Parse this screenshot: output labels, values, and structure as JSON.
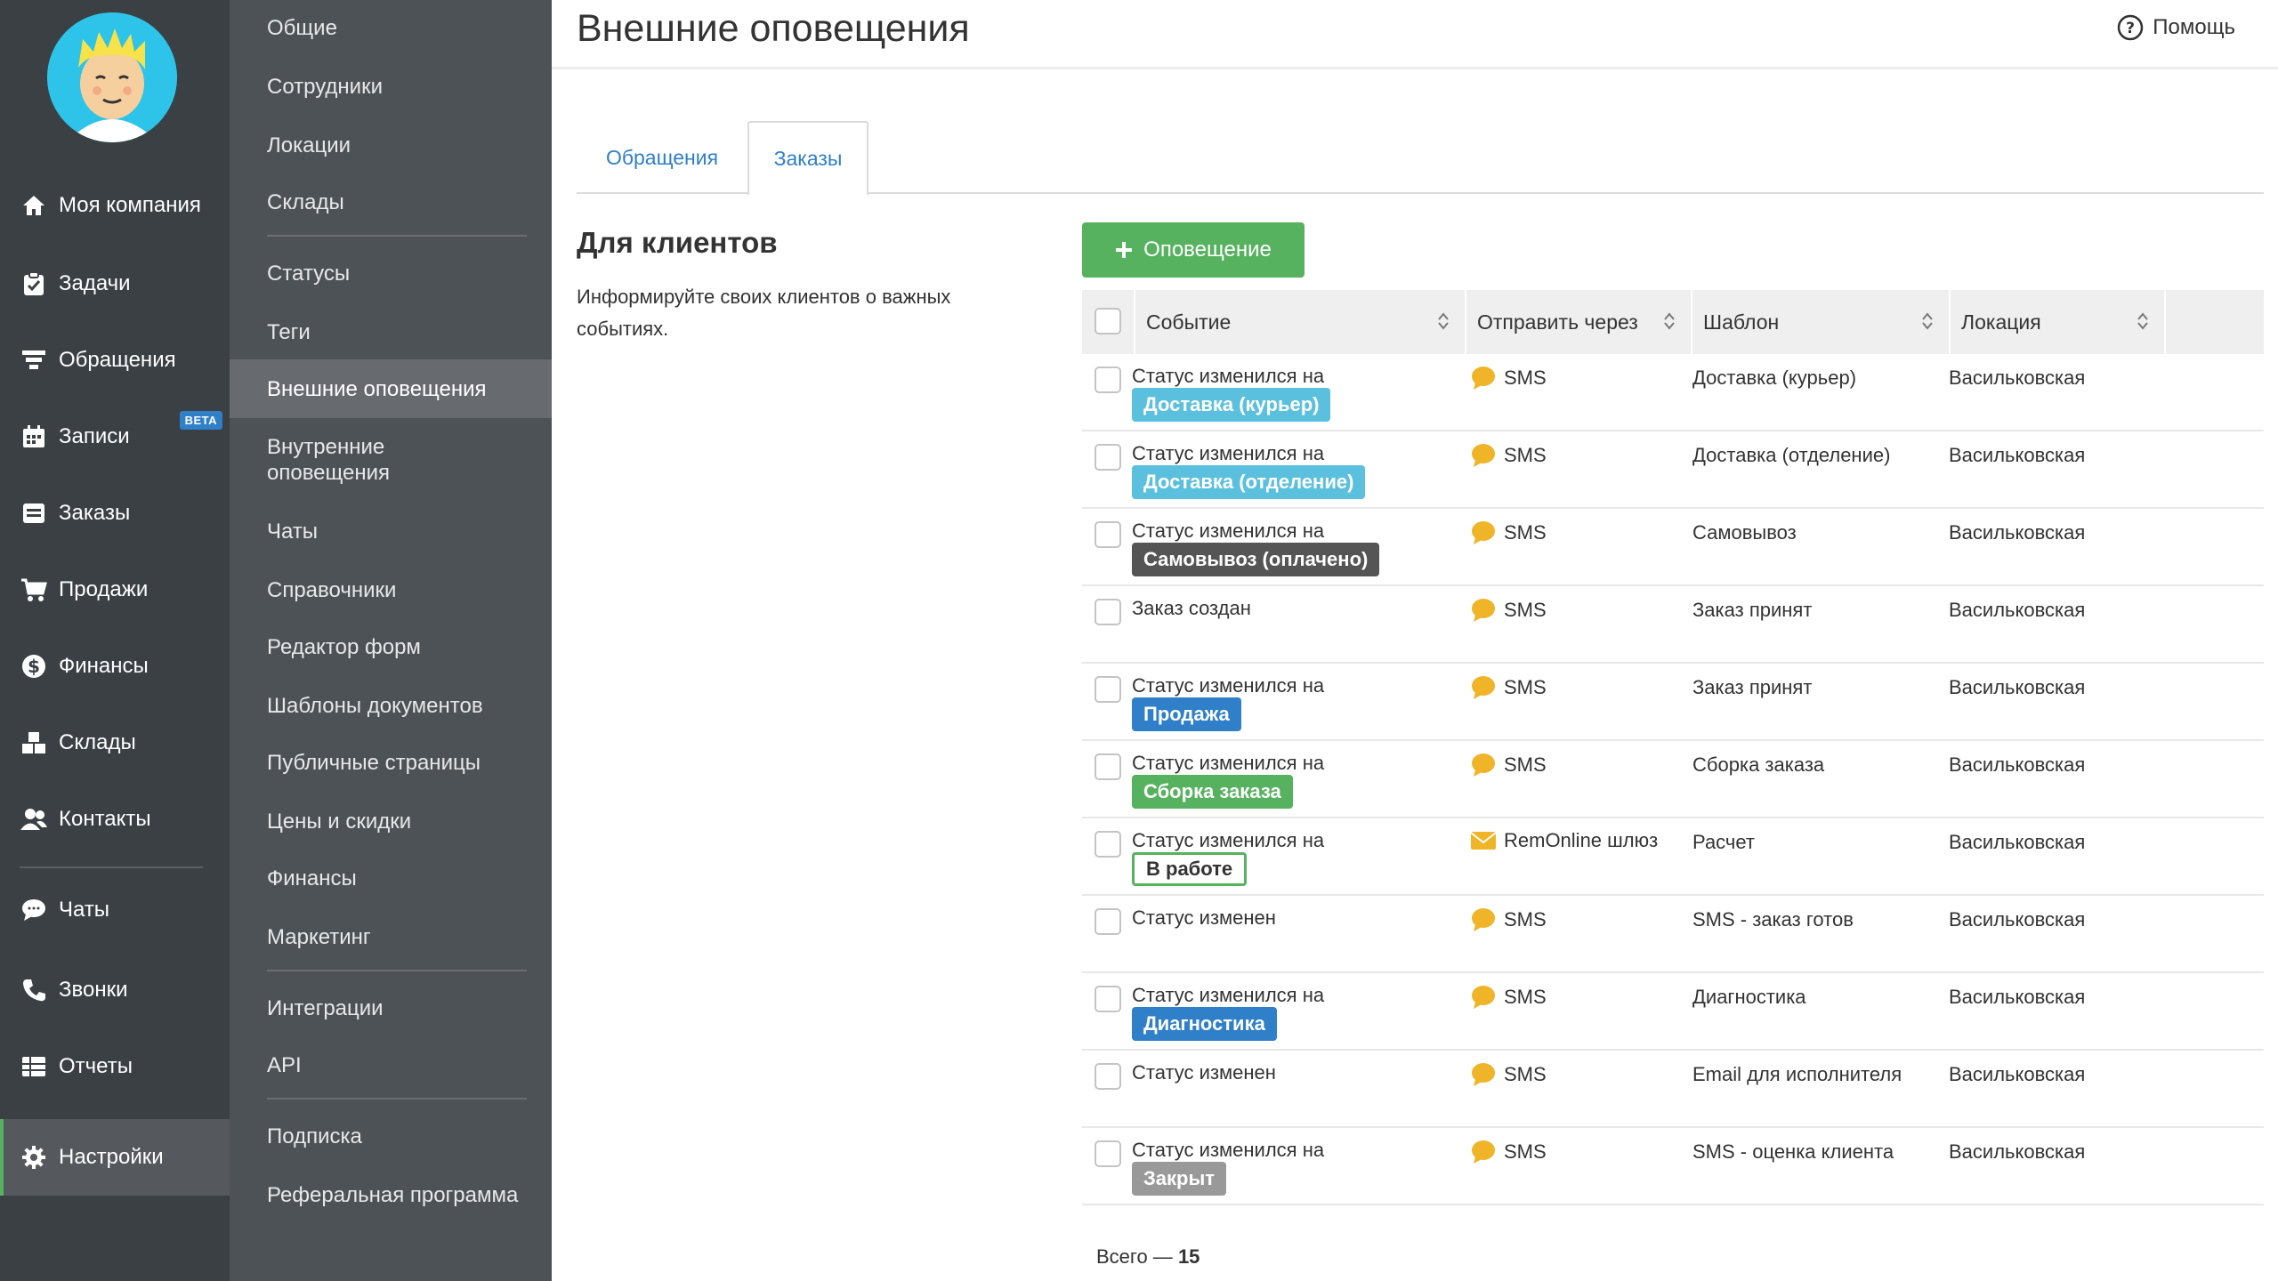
{
  "colors": {
    "nav_bg": "#3b4044",
    "subnav_bg": "#4d5256",
    "accent_green": "#57b25f",
    "link_blue": "#2f7fc9",
    "badge_courier": "#5bc0de",
    "badge_pickup_paid": "#555555",
    "badge_sale": "#2f7fc9",
    "badge_assembly": "#57b25f",
    "badge_diag": "#2f7fc9",
    "badge_closed": "#999999",
    "sms_icon": "#f0b429",
    "mail_icon": "#f0b429"
  },
  "nav": {
    "items": [
      {
        "label": "Моя компания",
        "icon": "home-icon"
      },
      {
        "label": "Задачи",
        "icon": "clipboard-icon"
      },
      {
        "label": "Обращения",
        "icon": "funnel-icon"
      },
      {
        "label": "Записи",
        "icon": "calendar-icon",
        "badge": "BETA"
      },
      {
        "label": "Заказы",
        "icon": "orders-icon"
      },
      {
        "label": "Продажи",
        "icon": "cart-icon"
      },
      {
        "label": "Финансы",
        "icon": "dollar-icon"
      },
      {
        "label": "Склады",
        "icon": "boxes-icon"
      },
      {
        "label": "Контакты",
        "icon": "contacts-icon"
      },
      {
        "label": "Чаты",
        "icon": "chat-icon"
      },
      {
        "label": "Звонки",
        "icon": "phone-icon"
      },
      {
        "label": "Отчеты",
        "icon": "reports-icon"
      },
      {
        "label": "Настройки",
        "icon": "gear-icon"
      }
    ]
  },
  "subnav": {
    "items": [
      "Общие",
      "Сотрудники",
      "Локации",
      "Склады",
      "Статусы",
      "Теги",
      "Внешние оповещения",
      "Внутренние оповещения",
      "Чаты",
      "Справочники",
      "Редактор форм",
      "Шаблоны документов",
      "Публичные страницы",
      "Цены и скидки",
      "Финансы",
      "Маркетинг",
      "Интеграции",
      "API",
      "Подписка",
      "Реферальная программа"
    ]
  },
  "header": {
    "title": "Внешние оповещения",
    "help": "Помощь"
  },
  "tabs": [
    "Обращения",
    "Заказы"
  ],
  "section": {
    "title": "Для клиентов",
    "description": "Информируйте своих клиентов о важных событиях."
  },
  "add_button": "Оповещение",
  "table": {
    "columns": [
      "Событие",
      "Отправить через",
      "Шаблон",
      "Локация"
    ],
    "rows": [
      {
        "event": "Статус изменился на",
        "badge": "Доставка (курьер)",
        "via": "SMS",
        "template": "Доставка (курьер)",
        "location": "Васильковская"
      },
      {
        "event": "Статус изменился на",
        "badge": "Доставка (отделение)",
        "via": "SMS",
        "template": "Доставка (отделение)",
        "location": "Васильковская"
      },
      {
        "event": "Статус изменился на",
        "badge": "Самовывоз (оплачено)",
        "via": "SMS",
        "template": "Самовывоз",
        "location": "Васильковская"
      },
      {
        "event": "Заказ создан",
        "badge": "",
        "via": "SMS",
        "template": "Заказ принят",
        "location": "Васильковская"
      },
      {
        "event": "Статус изменился на",
        "badge": "Продажа",
        "via": "SMS",
        "template": "Заказ принят",
        "location": "Васильковская"
      },
      {
        "event": "Статус изменился на",
        "badge": "Сборка заказа",
        "via": "SMS",
        "template": "Сборка заказа",
        "location": "Васильковская"
      },
      {
        "event": "Статус изменился на",
        "badge": "В работе",
        "via": "RemOnline шлюз",
        "template": "Расчет",
        "location": "Васильковская"
      },
      {
        "event": "Статус изменен",
        "badge": "",
        "via": "SMS",
        "template": "SMS - заказ готов",
        "location": "Васильковская"
      },
      {
        "event": "Статус изменился на",
        "badge": "Диагностика",
        "via": "SMS",
        "template": "Диагностика",
        "location": "Васильковская"
      },
      {
        "event": "Статус изменен",
        "badge": "",
        "via": "SMS",
        "template": "Email для исполнителя",
        "location": "Васильковская"
      },
      {
        "event": "Статус изменился на",
        "badge": "Закрыт",
        "via": "SMS",
        "template": "SMS - оценка клиента",
        "location": "Васильковская"
      }
    ]
  },
  "footer": {
    "total_label": "Всего —",
    "total_value": "15"
  }
}
